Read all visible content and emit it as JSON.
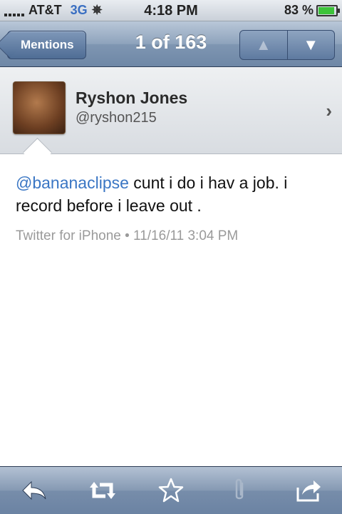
{
  "status": {
    "carrier": "AT&T",
    "network": "3G",
    "time": "4:18 PM",
    "battery_percent_label": "83 %",
    "battery_level": 0.83
  },
  "nav": {
    "back_label": "Mentions",
    "title": "1 of 163",
    "up_icon": "triangle-up",
    "down_icon": "triangle-down"
  },
  "profile": {
    "name": "Ryshon Jones",
    "handle": "@ryshon215"
  },
  "tweet": {
    "mention": "@bananaclipse",
    "text": " cunt i do i hav a job. i record before i leave out .",
    "meta": "Twitter for iPhone • 11/16/11 3:04 PM"
  },
  "toolbar": {
    "icons": [
      "reply-icon",
      "retweet-icon",
      "favorite-icon",
      "attach-icon",
      "share-icon"
    ]
  },
  "colors": {
    "accent": "#3a76c4",
    "nav_bar": "#7f96b2"
  }
}
